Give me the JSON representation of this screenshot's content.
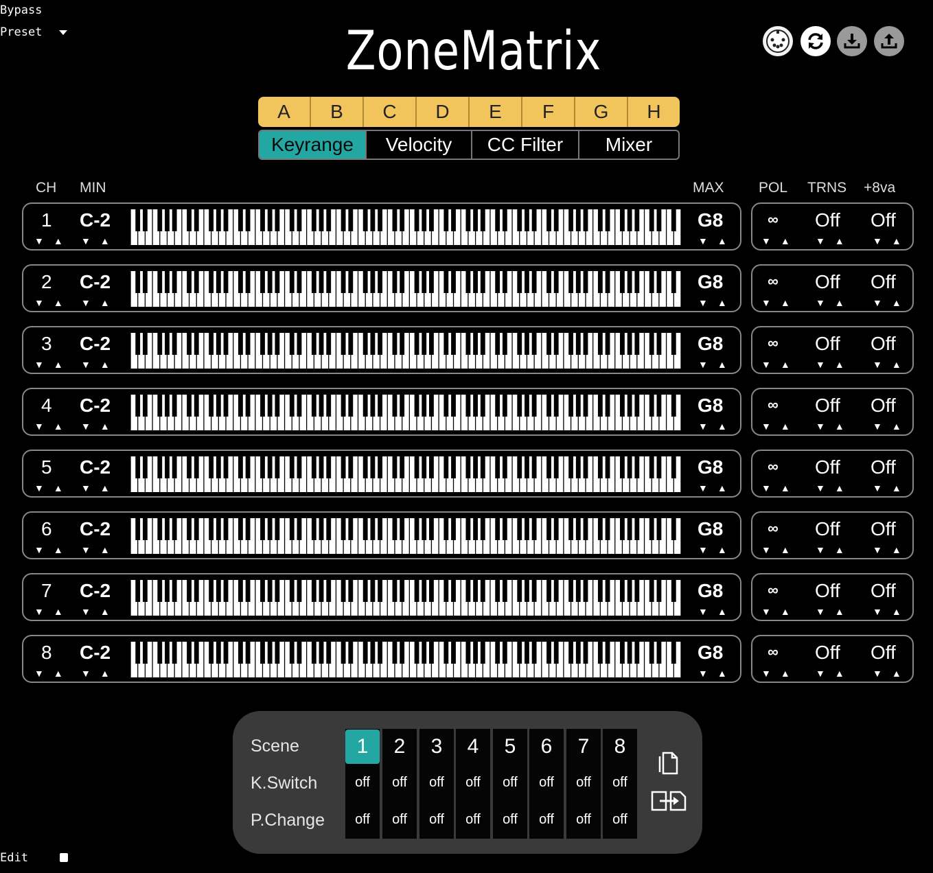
{
  "host": {
    "bypass": "Bypass",
    "preset": "Preset",
    "edit": "Edit"
  },
  "app_title": "ZoneMatrix",
  "toolbar_icons": [
    "midi-port-icon",
    "refresh-icon",
    "download-icon",
    "upload-icon"
  ],
  "zone_tabs": [
    "A",
    "B",
    "C",
    "D",
    "E",
    "F",
    "G",
    "H"
  ],
  "mode_tabs": [
    {
      "label": "Keyrange",
      "active": true
    },
    {
      "label": "Velocity",
      "active": false
    },
    {
      "label": "CC Filter",
      "active": false
    },
    {
      "label": "Mixer",
      "active": false
    }
  ],
  "headers": {
    "ch": "CH",
    "min": "MIN",
    "max": "MAX",
    "pol": "POL",
    "trns": "TRNS",
    "oct": "+8va"
  },
  "channels": [
    {
      "ch": "1",
      "min": "C-2",
      "max": "G8",
      "pol": "∞",
      "trns": "Off",
      "oct": "Off"
    },
    {
      "ch": "2",
      "min": "C-2",
      "max": "G8",
      "pol": "∞",
      "trns": "Off",
      "oct": "Off"
    },
    {
      "ch": "3",
      "min": "C-2",
      "max": "G8",
      "pol": "∞",
      "trns": "Off",
      "oct": "Off"
    },
    {
      "ch": "4",
      "min": "C-2",
      "max": "G8",
      "pol": "∞",
      "trns": "Off",
      "oct": "Off"
    },
    {
      "ch": "5",
      "min": "C-2",
      "max": "G8",
      "pol": "∞",
      "trns": "Off",
      "oct": "Off"
    },
    {
      "ch": "6",
      "min": "C-2",
      "max": "G8",
      "pol": "∞",
      "trns": "Off",
      "oct": "Off"
    },
    {
      "ch": "7",
      "min": "C-2",
      "max": "G8",
      "pol": "∞",
      "trns": "Off",
      "oct": "Off"
    },
    {
      "ch": "8",
      "min": "C-2",
      "max": "G8",
      "pol": "∞",
      "trns": "Off",
      "oct": "Off"
    }
  ],
  "scene_panel": {
    "labels": {
      "scene": "Scene",
      "kswitch": "K.Switch",
      "pchange": "P.Change"
    },
    "scenes": [
      {
        "num": "1",
        "kswitch": "off",
        "pchange": "off",
        "active": true
      },
      {
        "num": "2",
        "kswitch": "off",
        "pchange": "off",
        "active": false
      },
      {
        "num": "3",
        "kswitch": "off",
        "pchange": "off",
        "active": false
      },
      {
        "num": "4",
        "kswitch": "off",
        "pchange": "off",
        "active": false
      },
      {
        "num": "5",
        "kswitch": "off",
        "pchange": "off",
        "active": false
      },
      {
        "num": "6",
        "kswitch": "off",
        "pchange": "off",
        "active": false
      },
      {
        "num": "7",
        "kswitch": "off",
        "pchange": "off",
        "active": false
      },
      {
        "num": "8",
        "kswitch": "off",
        "pchange": "off",
        "active": false
      }
    ]
  },
  "colors": {
    "accent": "#22a7a3",
    "zone_tab": "#f2c55c",
    "panel": "#3a3a3a"
  }
}
